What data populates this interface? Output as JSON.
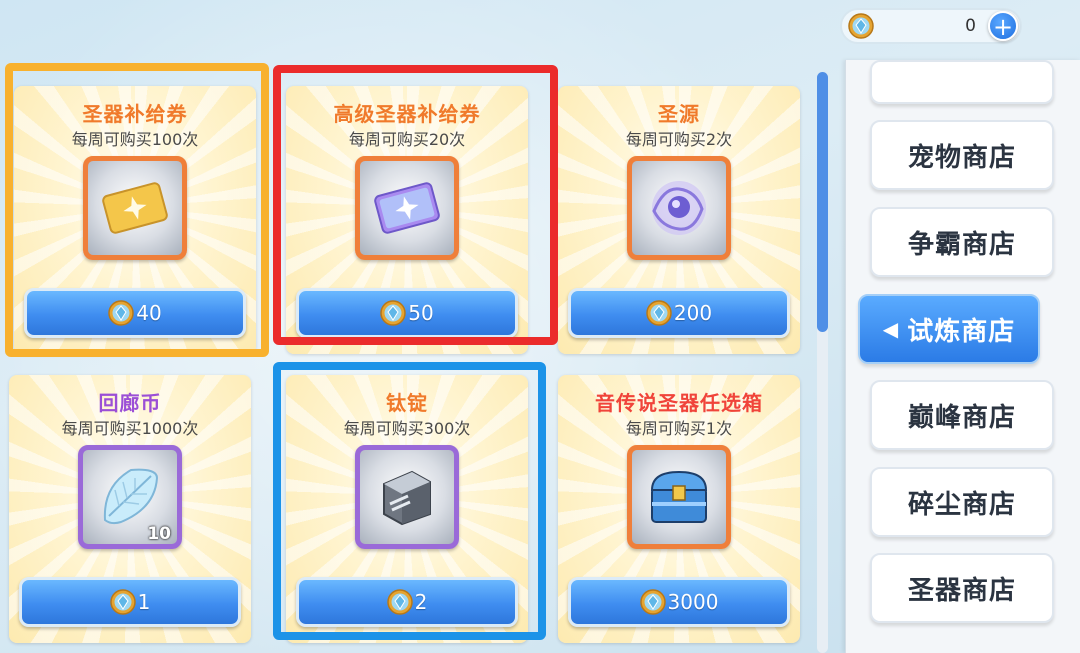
{
  "currency": {
    "amount": "0",
    "plus_label": "+"
  },
  "items": [
    {
      "name": "圣器补给券",
      "limit": "每周可购买100次",
      "price": "40",
      "qty": ""
    },
    {
      "name": "高级圣器补给券",
      "limit": "每周可购买20次",
      "price": "50",
      "qty": ""
    },
    {
      "name": "圣源",
      "limit": "每周可购买2次",
      "price": "200",
      "qty": ""
    },
    {
      "name": "回廊币",
      "limit": "每周可购买1000次",
      "price": "1",
      "qty": "10"
    },
    {
      "name": "钛锭",
      "limit": "每周可购买300次",
      "price": "2",
      "qty": ""
    },
    {
      "name": "音传说圣器任选箱",
      "limit": "每周可购买1次",
      "price": "3000",
      "qty": ""
    }
  ],
  "shop_nav": [
    {
      "label": "",
      "partial": true
    },
    {
      "label": "宠物商店"
    },
    {
      "label": "争霸商店"
    },
    {
      "label": "试炼商店",
      "active": true,
      "arrow": "◀"
    },
    {
      "label": "巅峰商店"
    },
    {
      "label": "碎尘商店"
    },
    {
      "label": "圣器商店"
    }
  ],
  "colors": {
    "accent_blue": "#3f8df0",
    "title_orange": "#f07a2b",
    "title_purple": "#9b4fd6",
    "title_red": "#f0443a"
  }
}
